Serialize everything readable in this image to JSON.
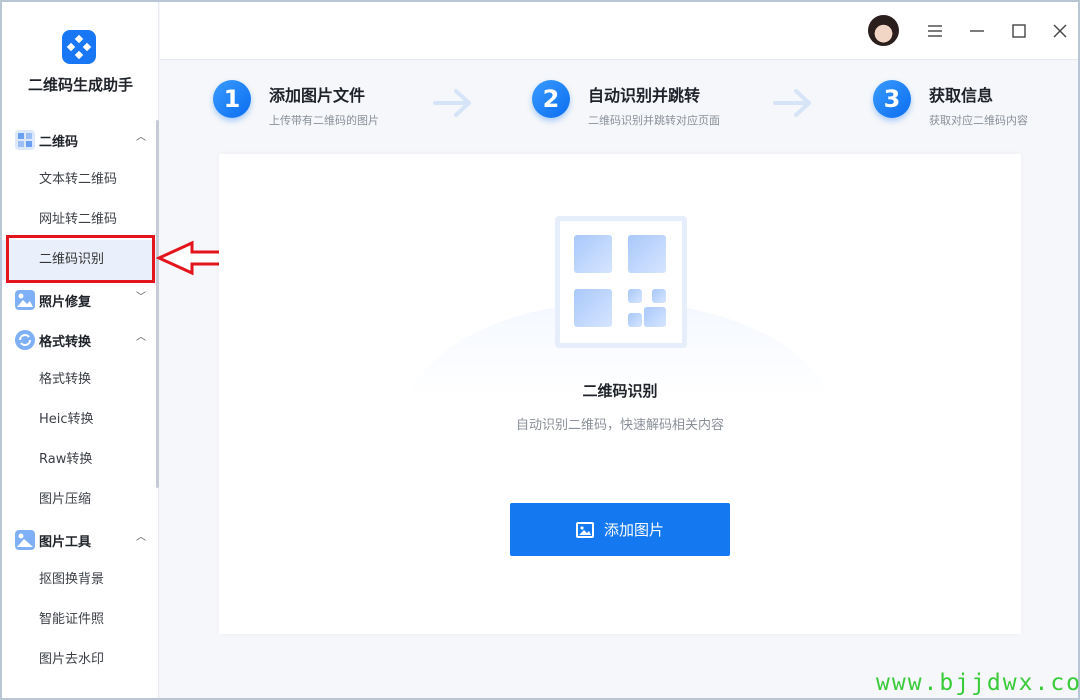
{
  "app": {
    "title": "二维码生成助手"
  },
  "sidebar": {
    "groups": [
      {
        "label": "二维码",
        "icon": "qrcode-icon",
        "expanded": true,
        "items": [
          "文本转二维码",
          "网址转二维码",
          "二维码识别"
        ]
      },
      {
        "label": "照片修复",
        "icon": "photo-repair-icon",
        "expanded": false,
        "items": []
      },
      {
        "label": "格式转换",
        "icon": "refresh-icon",
        "expanded": true,
        "items": [
          "格式转换",
          "Heic转换",
          "Raw转换",
          "图片压缩"
        ]
      },
      {
        "label": "图片工具",
        "icon": "image-tool-icon",
        "expanded": true,
        "items": [
          "抠图换背景",
          "智能证件照",
          "图片去水印"
        ]
      }
    ],
    "active_item": "二维码识别"
  },
  "header": {
    "menu_icon": "menu-icon",
    "minimize_icon": "minimize-icon",
    "maximize_icon": "maximize-icon",
    "close_icon": "close-icon"
  },
  "steps": [
    {
      "num": "1",
      "title": "添加图片文件",
      "sub": "上传带有二维码的图片"
    },
    {
      "num": "2",
      "title": "自动识别并跳转",
      "sub": "二维码识别并跳转对应页面"
    },
    {
      "num": "3",
      "title": "获取信息",
      "sub": "获取对应二维码内容"
    }
  ],
  "main": {
    "title": "二维码识别",
    "subtitle": "自动识别二维码，快速解码相关内容",
    "add_button": "添加图片"
  },
  "watermark": "www.bjjdwx.com",
  "colors": {
    "accent": "#1478f0",
    "highlight": "#e3141c",
    "watermark": "#3acb3a"
  }
}
